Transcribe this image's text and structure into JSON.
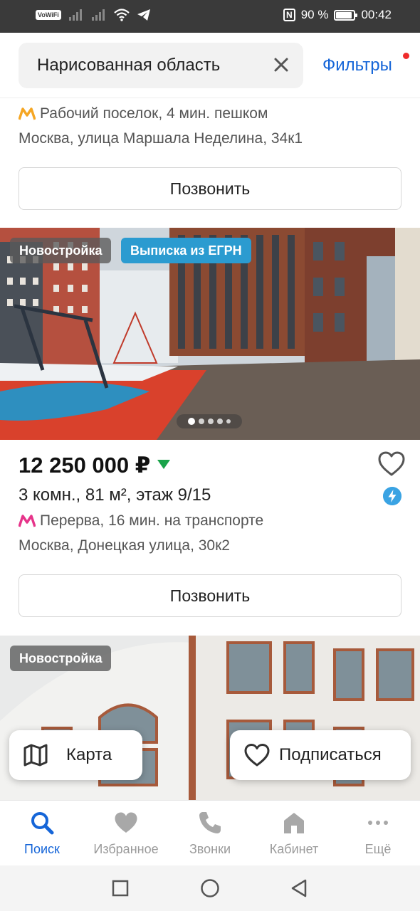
{
  "status_bar": {
    "vowifi": "VoWiFi",
    "battery_percent": "90 %",
    "battery_level": 0.9,
    "time": "00:42"
  },
  "search": {
    "query": "Нарисованная область",
    "filters_label": "Фильтры",
    "filters_dot_color": "#ef2b2b"
  },
  "listing_prev": {
    "metro": "Рабочий поселок, 4 мин. пешком",
    "metro_color": "#f5a623",
    "address": "Москва, улица Маршала Неделина, 34к1",
    "call_label": "Позвонить"
  },
  "listing": {
    "badge_new": "Новостройка",
    "badge_egrn": "Выписка из ЕГРН",
    "photo_count": 5,
    "photo_active": 1,
    "price": "12 250 000 ₽",
    "price_trend": "down",
    "description": "3 комн., 81 м², этаж 9/15",
    "metro": "Перерва, 16 мин. на транспорте",
    "metro_color": "#e6348a",
    "address": "Москва, Донецкая улица, 30к2",
    "call_label": "Позвонить"
  },
  "listing_next": {
    "badge_new": "Новостройка"
  },
  "floating": {
    "map_label": "Карта",
    "subscribe_label": "Подписаться"
  },
  "nav": {
    "items": [
      {
        "label": "Поиск",
        "icon": "search-icon",
        "active": true
      },
      {
        "label": "Избранное",
        "icon": "heart-icon",
        "active": false
      },
      {
        "label": "Звонки",
        "icon": "phone-icon",
        "active": false
      },
      {
        "label": "Кабинет",
        "icon": "home-icon",
        "active": false
      },
      {
        "label": "Ещё",
        "icon": "more-icon",
        "active": false
      }
    ],
    "active_color": "#1565d8"
  }
}
